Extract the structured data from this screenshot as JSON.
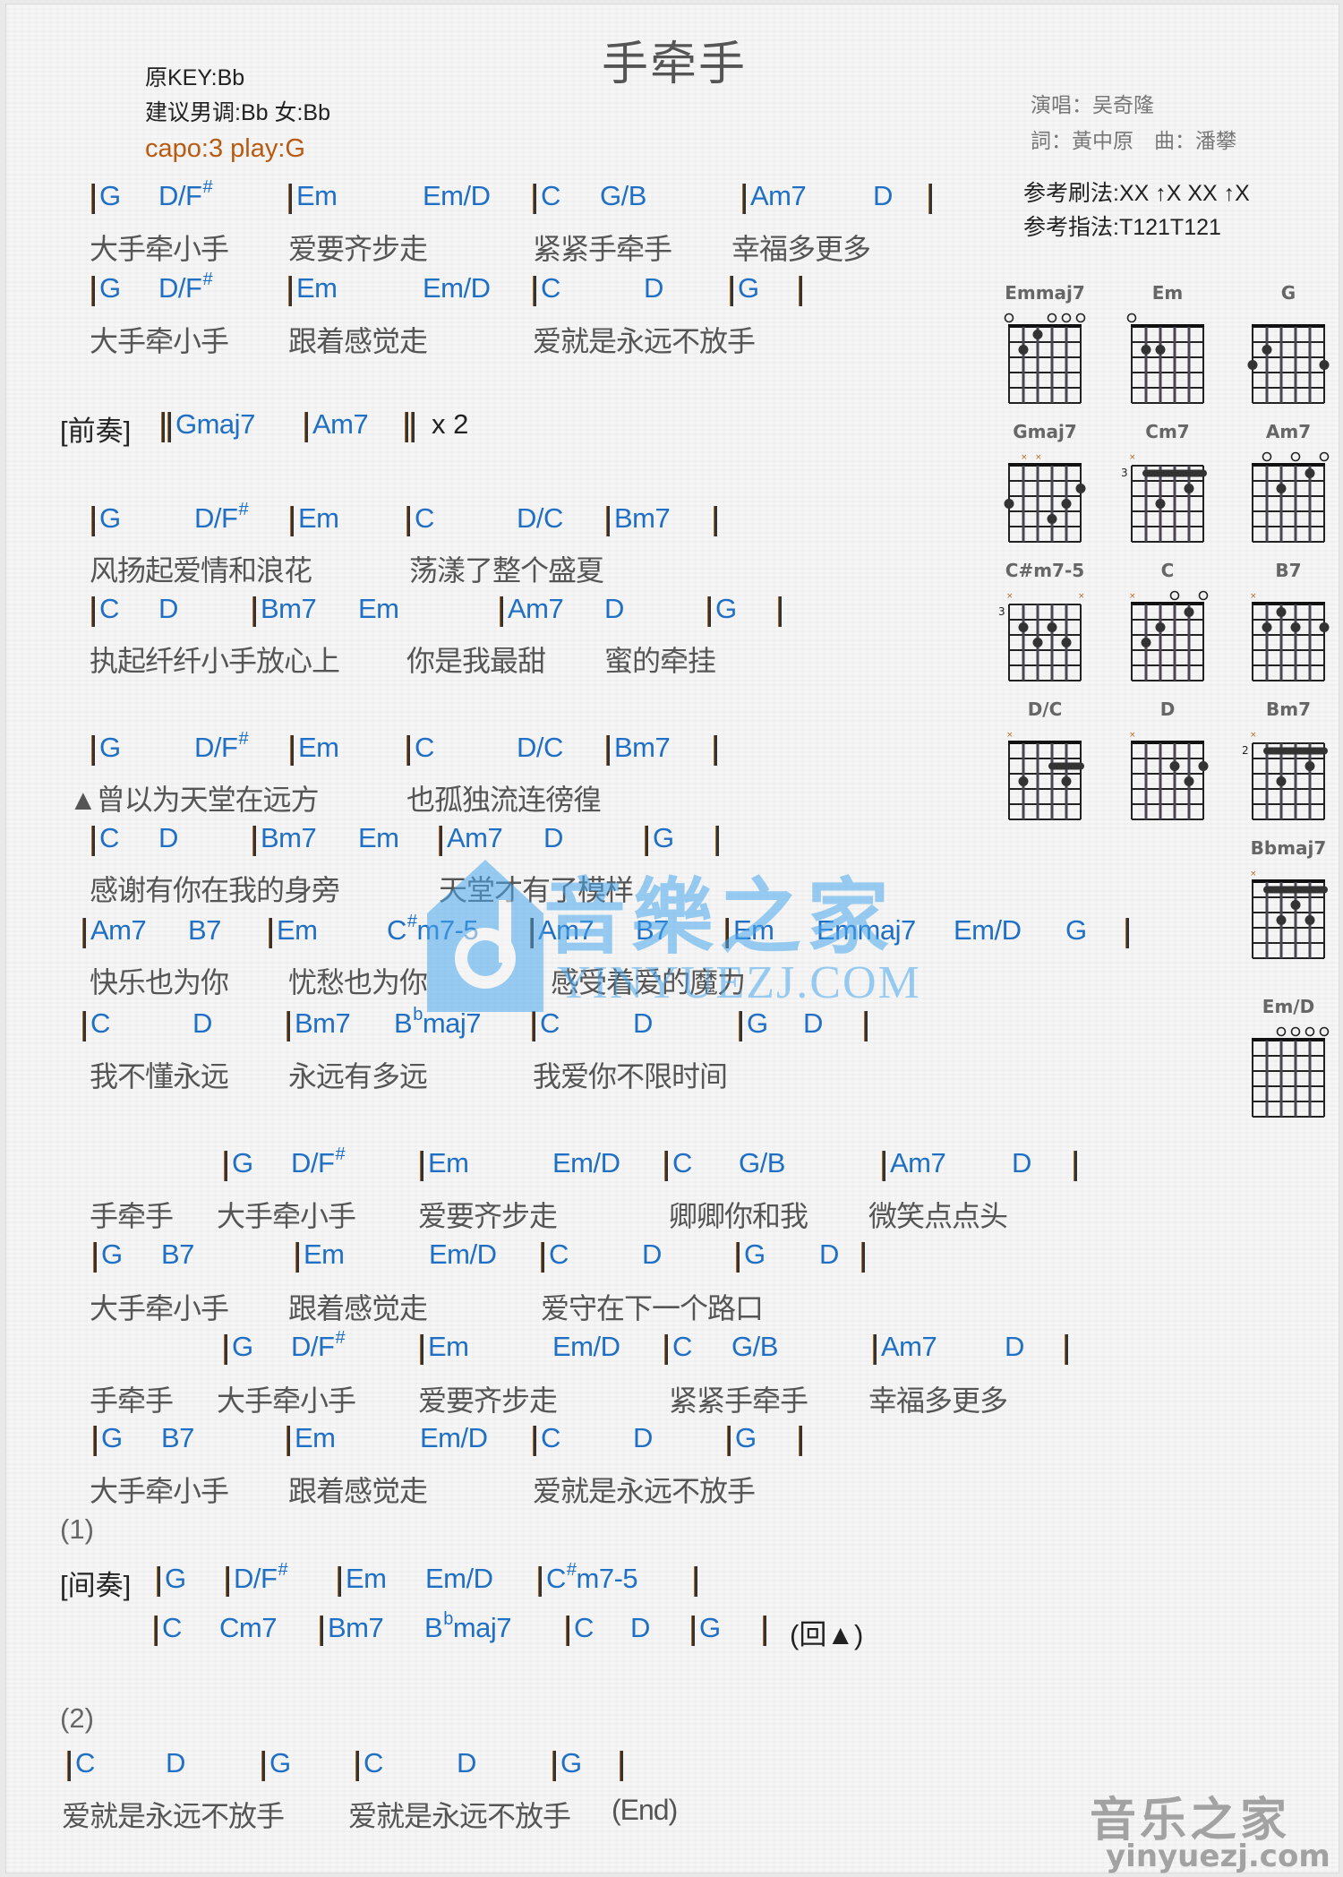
{
  "header": {
    "title": "手牵手",
    "original_key": "原KEY:Bb",
    "suggested_key": "建议男调:Bb 女:Bb",
    "capo": "capo:3 play:G",
    "singer": "演唱：吴奇隆",
    "writers": "詞：黃中原　曲：潘攀",
    "strum": "参考刷法:XX ↑X XX ↑X",
    "pick": "参考指法:T121T121"
  },
  "sections": {
    "intro_label": "[前奏]",
    "intro_repeat": "x 2",
    "interlude_label": "[间奏]",
    "ending1_label": "(1)",
    "ending2_label": "(2)",
    "return_mark": "(回▲)",
    "end_mark": "(End)"
  },
  "lines": [
    {
      "chords": [
        [
          "|",
          "G"
        ],
        [
          "",
          "D/F",
          "#"
        ],
        [
          "|",
          "Em"
        ],
        [
          "",
          "Em/D"
        ],
        [
          "|",
          "C"
        ],
        [
          "",
          "G/B"
        ],
        [
          "|",
          "Am7"
        ],
        [
          "",
          "D"
        ],
        [
          "|",
          ""
        ]
      ],
      "lyrics": [
        "大手牵小手",
        "爱要齐步走",
        "紧紧手牵手",
        "幸福多更多"
      ]
    },
    {
      "chords": [
        [
          "|",
          "G"
        ],
        [
          "",
          "D/F",
          "#"
        ],
        [
          "|",
          "Em"
        ],
        [
          "",
          "Em/D"
        ],
        [
          "|",
          "C"
        ],
        [
          "",
          "D"
        ],
        [
          "|",
          "G"
        ],
        [
          "|",
          ""
        ]
      ],
      "lyrics": [
        "大手牵小手",
        "跟着感觉走",
        "爱就是永远不放手"
      ]
    },
    {
      "chords": [
        [
          "||",
          "Gmaj7"
        ],
        [
          "|",
          "Am7"
        ],
        [
          "||",
          ""
        ]
      ]
    },
    {
      "chords": [
        [
          "|",
          "G"
        ],
        [
          "",
          "D/F",
          "#"
        ],
        [
          "|",
          "Em"
        ],
        [
          "|",
          "C"
        ],
        [
          "",
          "D/C"
        ],
        [
          "|",
          "Bm7"
        ],
        [
          "|",
          ""
        ]
      ],
      "lyrics": [
        "风扬起爱情和浪花",
        "荡漾了整个盛夏"
      ]
    },
    {
      "chords": [
        [
          "|",
          "C"
        ],
        [
          "",
          "D"
        ],
        [
          "|",
          "Bm7"
        ],
        [
          "",
          "Em"
        ],
        [
          "|",
          "Am7"
        ],
        [
          "",
          "D"
        ],
        [
          "|",
          "G"
        ],
        [
          "|",
          ""
        ]
      ],
      "lyrics": [
        "执起纤纤小手放心上",
        "你是我最甜",
        "蜜的牵挂"
      ]
    },
    {
      "chords": [
        [
          "|",
          "G"
        ],
        [
          "",
          "D/F",
          "#"
        ],
        [
          "|",
          "Em"
        ],
        [
          "|",
          "C"
        ],
        [
          "",
          "D/C"
        ],
        [
          "|",
          "Bm7"
        ],
        [
          "|",
          ""
        ]
      ],
      "lyrics": [
        "▲曾以为天堂在远方",
        "也孤独流连徬徨"
      ]
    },
    {
      "chords": [
        [
          "|",
          "C"
        ],
        [
          "",
          "D"
        ],
        [
          "|",
          "Bm7"
        ],
        [
          "",
          "Em"
        ],
        [
          "|",
          "Am7"
        ],
        [
          "",
          "D"
        ],
        [
          "|",
          "G"
        ],
        [
          "|",
          ""
        ]
      ],
      "lyrics": [
        "感谢有你在我的身旁",
        "天堂才有了模样"
      ]
    },
    {
      "chords": [
        [
          "|",
          "Am7"
        ],
        [
          "",
          "B7"
        ],
        [
          "|",
          "Em"
        ],
        [
          "",
          "C",
          "#",
          "m7-5"
        ],
        [
          "|",
          "Am7"
        ],
        [
          "",
          "B7"
        ],
        [
          "|",
          "Em"
        ],
        [
          "",
          "Emmaj7"
        ],
        [
          "",
          "Em/D"
        ],
        [
          "",
          "G"
        ],
        [
          "|",
          ""
        ]
      ],
      "lyrics": [
        "快乐也为你",
        "忧愁也为你",
        "感受着爱的魔力"
      ]
    },
    {
      "chords": [
        [
          "|",
          "C"
        ],
        [
          "",
          "D"
        ],
        [
          "|",
          "Bm7"
        ],
        [
          "",
          "B",
          "b",
          "maj7"
        ],
        [
          "|",
          "C"
        ],
        [
          "",
          "D"
        ],
        [
          "|",
          "G"
        ],
        [
          "",
          "D"
        ],
        [
          "|",
          ""
        ]
      ],
      "lyrics": [
        "我不懂永远",
        "永远有多远",
        "我爱你不限时间"
      ]
    },
    {
      "chords": [
        [
          "|",
          "G"
        ],
        [
          "",
          "D/F",
          "#"
        ],
        [
          "|",
          "Em"
        ],
        [
          "",
          "Em/D"
        ],
        [
          "|",
          "C"
        ],
        [
          "",
          "G/B"
        ],
        [
          "|",
          "Am7"
        ],
        [
          "",
          "D"
        ],
        [
          "|",
          ""
        ]
      ],
      "lyrics": [
        "手牵手",
        "大手牵小手",
        "爱要齐步走",
        "卿卿你和我",
        "微笑点点头"
      ]
    },
    {
      "chords": [
        [
          "|",
          "G"
        ],
        [
          "",
          "B7"
        ],
        [
          "|",
          "Em"
        ],
        [
          "",
          "Em/D"
        ],
        [
          "|",
          "C"
        ],
        [
          "",
          "D"
        ],
        [
          "|",
          "G"
        ],
        [
          "",
          "D"
        ],
        [
          "|",
          ""
        ]
      ],
      "lyrics": [
        "大手牵小手",
        "跟着感觉走",
        "爱守在下一个路口"
      ]
    },
    {
      "chords": [
        [
          "|",
          "G"
        ],
        [
          "",
          "D/F",
          "#"
        ],
        [
          "|",
          "Em"
        ],
        [
          "",
          "Em/D"
        ],
        [
          "|",
          "C"
        ],
        [
          "",
          "G/B"
        ],
        [
          "|",
          "Am7"
        ],
        [
          "",
          "D"
        ],
        [
          "|",
          ""
        ]
      ],
      "lyrics": [
        "手牵手",
        "大手牵小手",
        "爱要齐步走",
        "紧紧手牵手",
        "幸福多更多"
      ]
    },
    {
      "chords": [
        [
          "|",
          "G"
        ],
        [
          "",
          "B7"
        ],
        [
          "|",
          "Em"
        ],
        [
          "",
          "Em/D"
        ],
        [
          "|",
          "C"
        ],
        [
          "",
          "D"
        ],
        [
          "|",
          "G"
        ],
        [
          "|",
          ""
        ]
      ],
      "lyrics": [
        "大手牵小手",
        "跟着感觉走",
        "爱就是永远不放手"
      ]
    },
    {
      "chords": [
        [
          "|",
          "G"
        ],
        [
          "|",
          "D/F",
          "#"
        ],
        [
          "|",
          "Em"
        ],
        [
          "",
          "Em/D"
        ],
        [
          "|",
          "C",
          "#",
          "m7-5"
        ],
        [
          "|",
          ""
        ]
      ]
    },
    {
      "chords": [
        [
          "|",
          "C"
        ],
        [
          "",
          "Cm7"
        ],
        [
          "|",
          "Bm7"
        ],
        [
          "",
          "B",
          "b",
          "maj7"
        ],
        [
          "|",
          "C"
        ],
        [
          "",
          "D"
        ],
        [
          "|",
          "G"
        ],
        [
          "|",
          ""
        ]
      ]
    },
    {
      "chords": [
        [
          "|",
          "C"
        ],
        [
          "",
          "D"
        ],
        [
          "|",
          "G"
        ],
        [
          "|",
          "C"
        ],
        [
          "",
          "D"
        ],
        [
          "|",
          "G"
        ],
        [
          "|",
          ""
        ]
      ],
      "lyrics": [
        "爱就是永远不放手",
        "爱就是永远不放手"
      ]
    }
  ],
  "chord_diagrams": [
    {
      "name": "Emmaj7",
      "open": [
        1,
        4,
        5,
        6
      ],
      "muted": [],
      "fret_label": "",
      "dots": [
        [
          2,
          2
        ],
        [
          3,
          1
        ]
      ],
      "barre": null
    },
    {
      "name": "Em",
      "open": [
        1
      ],
      "muted": [],
      "fret_label": "",
      "dots": [
        [
          2,
          2
        ],
        [
          3,
          2
        ]
      ],
      "barre": null
    },
    {
      "name": "G",
      "open": [],
      "muted": [],
      "fret_label": "",
      "dots": [
        [
          1,
          3
        ],
        [
          2,
          2
        ],
        [
          6,
          3
        ]
      ],
      "barre": null
    },
    {
      "name": "Gmaj7",
      "open": [],
      "muted": [
        2,
        3
      ],
      "fret_label": "",
      "dots": [
        [
          1,
          3
        ],
        [
          4,
          4
        ],
        [
          5,
          3
        ],
        [
          6,
          2
        ]
      ],
      "barre": null
    },
    {
      "name": "Cm7",
      "open": [],
      "muted": [
        1
      ],
      "fret_label": "3",
      "dots": [
        [
          3,
          3
        ],
        [
          5,
          2
        ]
      ],
      "barre": [
        2,
        6,
        1
      ]
    },
    {
      "name": "Am7",
      "open": [
        2,
        4,
        6
      ],
      "muted": [],
      "fret_label": "",
      "dots": [
        [
          3,
          2
        ],
        [
          5,
          1
        ]
      ],
      "barre": null
    },
    {
      "name": "C#m7-5",
      "open": [],
      "muted": [
        1,
        6
      ],
      "fret_label": "3",
      "dots": [
        [
          2,
          2
        ],
        [
          3,
          3
        ],
        [
          4,
          2
        ],
        [
          5,
          3
        ]
      ],
      "barre": null
    },
    {
      "name": "C",
      "open": [
        4,
        6
      ],
      "muted": [
        1
      ],
      "fret_label": "",
      "dots": [
        [
          2,
          3
        ],
        [
          3,
          2
        ],
        [
          5,
          1
        ]
      ],
      "barre": null
    },
    {
      "name": "B7",
      "open": [],
      "muted": [
        1
      ],
      "fret_label": "",
      "dots": [
        [
          2,
          2
        ],
        [
          3,
          1
        ],
        [
          4,
          2
        ],
        [
          6,
          2
        ]
      ],
      "barre": null
    },
    {
      "name": "D/C",
      "open": [],
      "muted": [
        1
      ],
      "fret_label": "",
      "dots": [
        [
          2,
          3
        ],
        [
          5,
          3
        ]
      ],
      "barre": [
        4,
        6,
        2
      ]
    },
    {
      "name": "D",
      "open": [],
      "muted": [
        1
      ],
      "fret_label": "",
      "dots": [
        [
          4,
          2
        ],
        [
          5,
          3
        ],
        [
          6,
          2
        ]
      ],
      "barre": null
    },
    {
      "name": "Bm7",
      "open": [],
      "muted": [
        1
      ],
      "fret_label": "2",
      "dots": [
        [
          3,
          3
        ],
        [
          5,
          2
        ]
      ],
      "barre": [
        2,
        6,
        1
      ]
    },
    {
      "name": "Bbmaj7",
      "open": [],
      "muted": [
        1
      ],
      "fret_label": "",
      "dots": [
        [
          3,
          3
        ],
        [
          4,
          2
        ],
        [
          5,
          3
        ]
      ],
      "barre": [
        2,
        6,
        1
      ]
    },
    {
      "name": "Em/D",
      "open": [
        3,
        4,
        5,
        6
      ],
      "muted": [],
      "fret_label": "",
      "dots": [],
      "barre": null
    }
  ],
  "watermark": {
    "center_text": "音樂之家",
    "center_url": "YINYUEZJ.COM",
    "corner_text": "音乐之家",
    "corner_url": "yinyuezj.com"
  },
  "colors": {
    "chord": "#1f6fc4",
    "lyric": "#555555",
    "capo": "#b85a10",
    "watermark": "#5bb4f0"
  }
}
